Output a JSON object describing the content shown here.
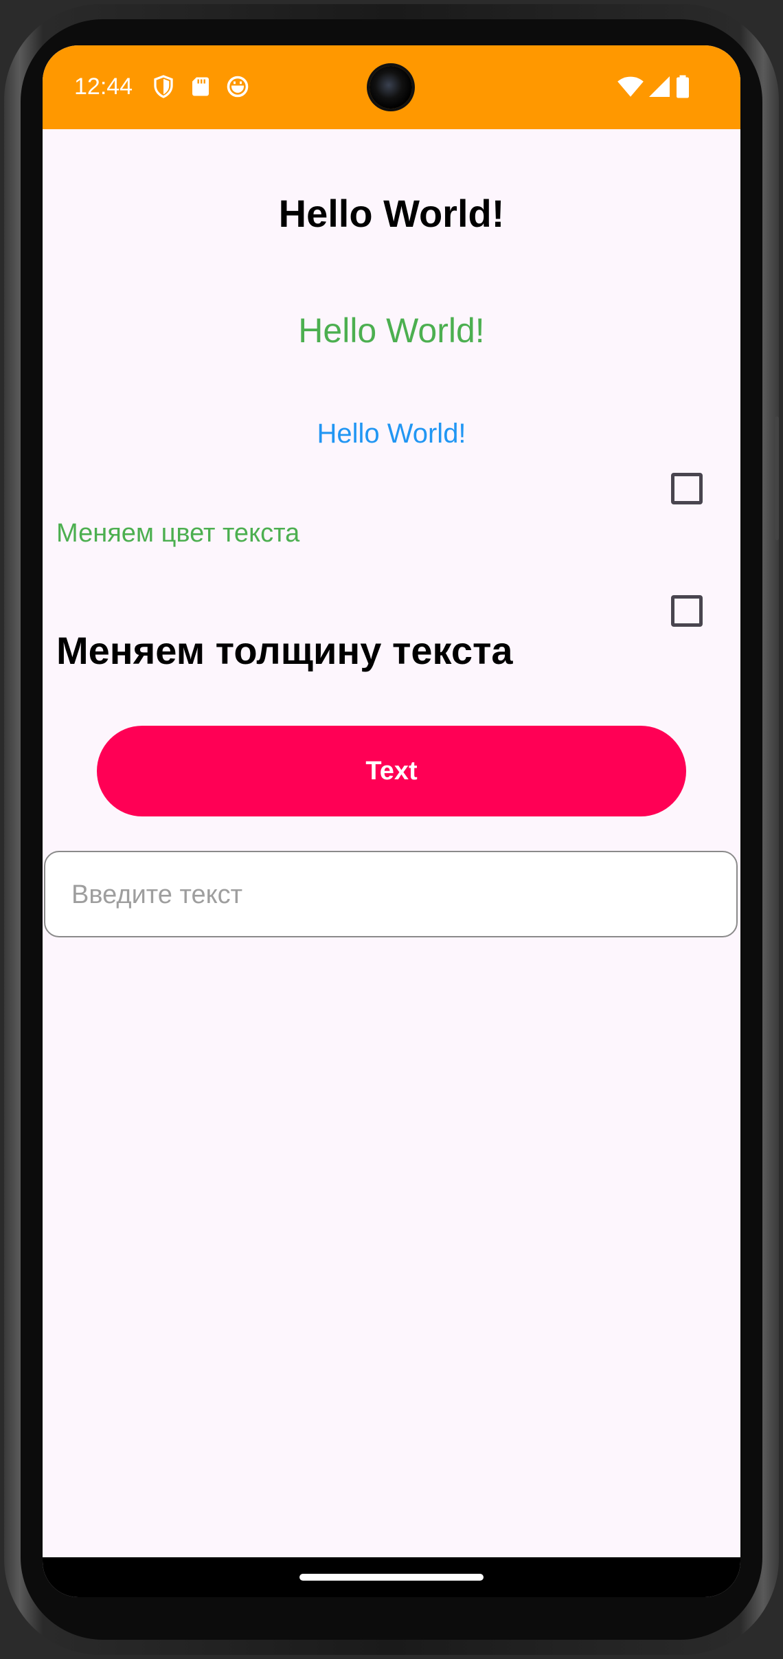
{
  "status_bar": {
    "time": "12:44",
    "background": "#ff9800",
    "left_icons": [
      "shield-icon",
      "sd-card-icon",
      "notification-app-icon"
    ],
    "right_icons": [
      "wifi-icon",
      "signal-icon",
      "battery-icon"
    ]
  },
  "main": {
    "heading_bold": "Hello World!",
    "heading_green": "Hello World!",
    "heading_blue": "Hello World!",
    "option_color": {
      "label": "Меняем цвет текста",
      "checked": false
    },
    "option_weight": {
      "label": "Меняем толщину текста",
      "checked": false
    },
    "button_label": "Text",
    "input": {
      "value": "",
      "placeholder": "Введите текст"
    }
  },
  "colors": {
    "accent_orange": "#ff9800",
    "green_text": "#4caf50",
    "blue_text": "#2196f3",
    "button_pink": "#ff0055",
    "screen_bg": "#fdf6fd"
  }
}
